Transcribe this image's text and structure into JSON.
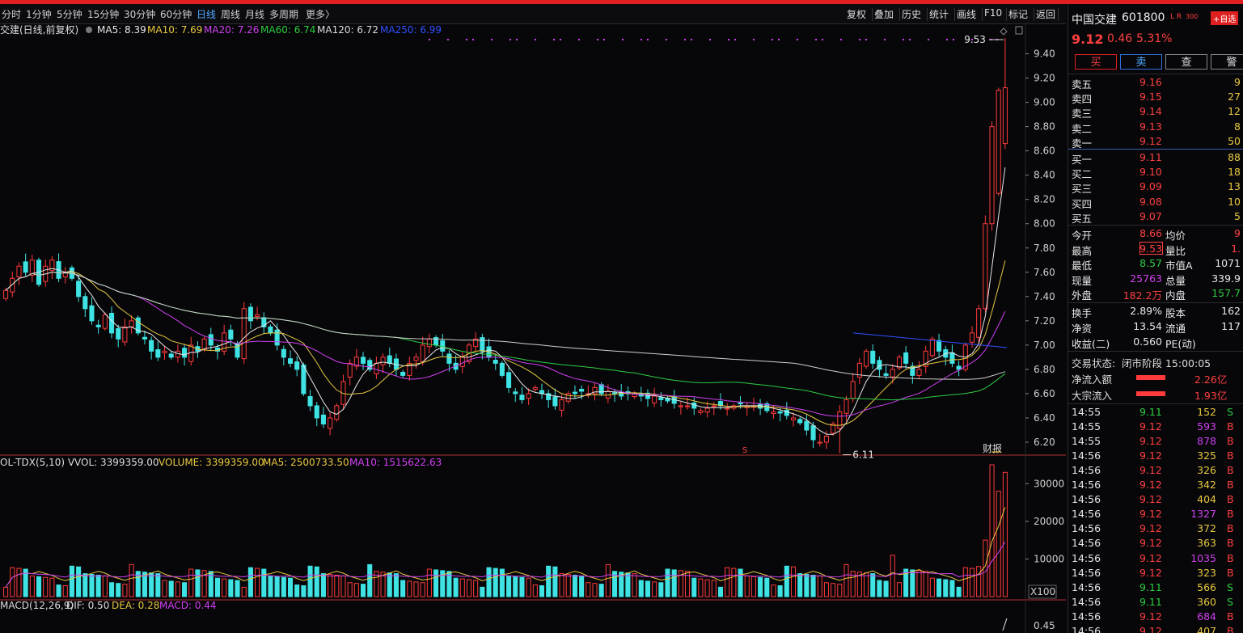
{
  "toolbar": {
    "periods": [
      "分时",
      "1分钟",
      "5分钟",
      "15分钟",
      "30分钟",
      "60分钟",
      "日线",
      "周线",
      "月线",
      "多周期",
      "更多〉"
    ],
    "active_period": "日线",
    "tools": [
      "复权",
      "叠加",
      "历史",
      "统计",
      "画线",
      "F10",
      "标记",
      "返回"
    ]
  },
  "main_legend": {
    "name": "交建(日线,前复权)",
    "items": [
      {
        "text": "MA5: 8.39",
        "color": "#e8e8e8"
      },
      {
        "text": "MA10: 7.69",
        "color": "#e8c840"
      },
      {
        "text": "MA20: 7.26",
        "color": "#d040f0"
      },
      {
        "text": "MA60: 6.74",
        "color": "#2ecc40"
      },
      {
        "text": "MA120: 6.72",
        "color": "#dddddd"
      },
      {
        "text": "MA250: 6.99",
        "color": "#3050ff"
      }
    ]
  },
  "price_axis": {
    "ticks": [
      "9.40",
      "9.20",
      "9.00",
      "8.80",
      "8.60",
      "8.40",
      "8.20",
      "8.00",
      "7.80",
      "7.60",
      "7.40",
      "7.20",
      "7.00",
      "6.80",
      "6.60",
      "6.40",
      "6.20"
    ]
  },
  "annotations": {
    "high": "9.53",
    "low": "6.11",
    "caibao": "财报",
    "s_marker": "S"
  },
  "vol_legend": {
    "items": [
      {
        "text": "OL-TDX(5,10) VVOL: 3399359.00",
        "color": "#dddddd"
      },
      {
        "text": "VOLUME: 3399359.00",
        "color": "#e8c840"
      },
      {
        "text": "MA5: 2500733.50",
        "color": "#e8c840"
      },
      {
        "text": "MA10: 1515622.63",
        "color": "#d040f0"
      }
    ]
  },
  "vol_axis": {
    "ticks": [
      "30000",
      "20000",
      "10000"
    ],
    "unit": "X100"
  },
  "macd_legend": {
    "items": [
      {
        "text": "MACD(12,26,9)",
        "color": "#dddddd"
      },
      {
        "text": "DIF: 0.50",
        "color": "#dddddd"
      },
      {
        "text": "DEA: 0.28",
        "color": "#e8c840"
      },
      {
        "text": "MACD: 0.44",
        "color": "#d040f0"
      }
    ]
  },
  "macd_axis": {
    "ticks": [
      "0.45"
    ]
  },
  "chart_data": {
    "type": "candlestick",
    "ylim": [
      6.1,
      9.55
    ],
    "close": [
      7.45,
      7.55,
      7.65,
      7.6,
      7.7,
      7.5,
      7.65,
      7.7,
      7.55,
      7.6,
      7.55,
      7.4,
      7.3,
      7.2,
      7.15,
      7.25,
      7.1,
      7.05,
      7.15,
      7.2,
      7.1,
      7.05,
      6.95,
      6.9,
      6.95,
      6.9,
      6.95,
      6.9,
      7.0,
      6.95,
      7.05,
      7.0,
      6.95,
      7.1,
      7.05,
      6.9,
      7.3,
      7.2,
      7.25,
      7.15,
      7.1,
      7.0,
      6.9,
      6.85,
      6.8,
      6.6,
      6.5,
      6.4,
      6.35,
      6.4,
      6.5,
      6.7,
      6.85,
      6.9,
      6.85,
      6.8,
      6.85,
      6.9,
      6.85,
      6.8,
      6.75,
      6.85,
      6.9,
      7.0,
      7.05,
      7.0,
      6.95,
      6.85,
      6.8,
      6.9,
      7.0,
      7.05,
      6.95,
      6.9,
      6.85,
      6.75,
      6.65,
      6.6,
      6.55,
      6.6,
      6.65,
      6.6,
      6.55,
      6.5,
      6.55,
      6.6,
      6.6,
      6.62,
      6.6,
      6.65,
      6.6,
      6.62,
      6.6,
      6.58,
      6.6,
      6.6,
      6.58,
      6.56,
      6.58,
      6.55,
      6.54,
      6.52,
      6.5,
      6.5,
      6.48,
      6.46,
      6.48,
      6.5,
      6.5,
      6.48,
      6.5,
      6.52,
      6.5,
      6.5,
      6.48,
      6.46,
      6.45,
      6.44,
      6.42,
      6.4,
      6.36,
      6.3,
      6.22,
      6.2,
      6.25,
      6.35,
      6.45,
      6.55,
      6.7,
      6.85,
      6.95,
      6.85,
      6.8,
      6.75,
      6.8,
      6.9,
      6.85,
      6.75,
      6.8,
      6.95,
      7.05,
      6.95,
      6.9,
      6.85,
      6.8,
      7.0,
      7.1,
      7.3,
      8.0,
      8.8,
      9.1,
      9.12
    ],
    "volume_peak": 35000,
    "high": 9.53,
    "low": 6.11
  },
  "quote": {
    "name": "中国交建",
    "code": "601800",
    "flags": "L R",
    "flag_sub": "300",
    "fav": "+自选",
    "price": "9.12",
    "change": "0.46",
    "pct": "5.31%",
    "buttons": [
      "买",
      "卖",
      "查",
      "警"
    ]
  },
  "order_book": {
    "asks": [
      {
        "label": "卖五",
        "price": "9.16",
        "vol": "9"
      },
      {
        "label": "卖四",
        "price": "9.15",
        "vol": "27"
      },
      {
        "label": "卖三",
        "price": "9.14",
        "vol": "12"
      },
      {
        "label": "卖二",
        "price": "9.13",
        "vol": "8"
      },
      {
        "label": "卖一",
        "price": "9.12",
        "vol": "50"
      }
    ],
    "bids": [
      {
        "label": "买一",
        "price": "9.11",
        "vol": "88"
      },
      {
        "label": "买二",
        "price": "9.10",
        "vol": "18"
      },
      {
        "label": "买三",
        "price": "9.09",
        "vol": "13"
      },
      {
        "label": "买四",
        "price": "9.08",
        "vol": "10"
      },
      {
        "label": "买五",
        "price": "9.07",
        "vol": "5"
      }
    ]
  },
  "stats": [
    {
      "l": "今开",
      "v": "8.66",
      "c": "red",
      "l2": "均价",
      "v2": "9",
      "c2": "red"
    },
    {
      "l": "最高",
      "v": "9.53",
      "c": "red",
      "l2": "量比",
      "v2": "1.",
      "c2": "red"
    },
    {
      "l": "最低",
      "v": "8.57",
      "c": "grn",
      "l2": "市值A",
      "v2": "1071",
      "c2": "wht"
    },
    {
      "l": "现量",
      "v": "25763",
      "c": "vio",
      "l2": "总量",
      "v2": "339.9",
      "c2": "wht"
    },
    {
      "l": "外盘",
      "v": "182.2万",
      "c": "red",
      "l2": "内盘",
      "v2": "157.7",
      "c2": "grn"
    }
  ],
  "stats2": [
    {
      "l": "换手",
      "v": "2.89%",
      "l2": "股本",
      "v2": "162"
    },
    {
      "l": "净资",
      "v": "13.54",
      "l2": "流通",
      "v2": "117"
    },
    {
      "l": "收益(二)",
      "v": "0.560",
      "l2": "PE(动)",
      "v2": ""
    }
  ],
  "status": {
    "label": "交易状态:",
    "value": "闭市阶段 15:00:05"
  },
  "flows": [
    {
      "label": "净流入额",
      "value": "2.26亿"
    },
    {
      "label": "大宗流入",
      "value": "1.93亿"
    }
  ],
  "ticks": [
    {
      "t": "14:55",
      "p": "9.11",
      "v": "152",
      "s": "S"
    },
    {
      "t": "14:55",
      "p": "9.12",
      "v": "593",
      "s": "B"
    },
    {
      "t": "14:55",
      "p": "9.12",
      "v": "878",
      "s": "B"
    },
    {
      "t": "14:56",
      "p": "9.12",
      "v": "325",
      "s": "B"
    },
    {
      "t": "14:56",
      "p": "9.12",
      "v": "326",
      "s": "B"
    },
    {
      "t": "14:56",
      "p": "9.12",
      "v": "342",
      "s": "B"
    },
    {
      "t": "14:56",
      "p": "9.12",
      "v": "404",
      "s": "B"
    },
    {
      "t": "14:56",
      "p": "9.12",
      "v": "1327",
      "s": "B"
    },
    {
      "t": "14:56",
      "p": "9.12",
      "v": "372",
      "s": "B"
    },
    {
      "t": "14:56",
      "p": "9.12",
      "v": "363",
      "s": "B"
    },
    {
      "t": "14:56",
      "p": "9.12",
      "v": "1035",
      "s": "B"
    },
    {
      "t": "14:56",
      "p": "9.12",
      "v": "323",
      "s": "B"
    },
    {
      "t": "14:56",
      "p": "9.11",
      "v": "566",
      "s": "S"
    },
    {
      "t": "14:56",
      "p": "9.11",
      "v": "360",
      "s": "S"
    },
    {
      "t": "14:56",
      "p": "9.12",
      "v": "684",
      "s": "B"
    },
    {
      "t": "14:56",
      "p": "9.12",
      "v": "407",
      "s": "B"
    }
  ]
}
